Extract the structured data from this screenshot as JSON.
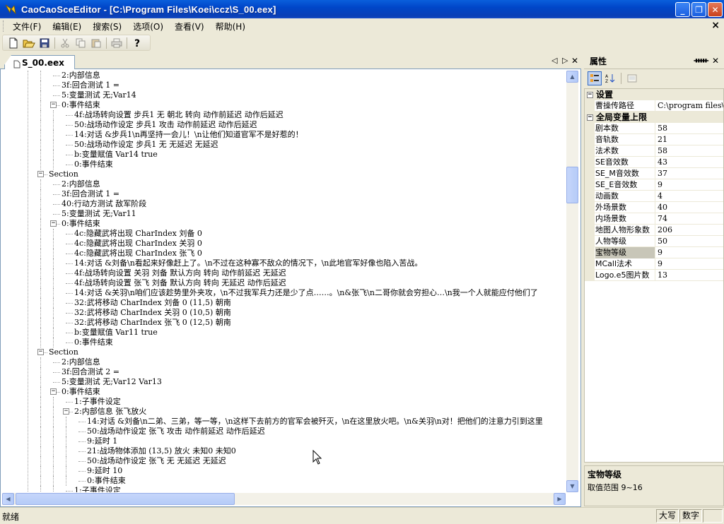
{
  "window": {
    "title": "CaoCaoSceEditor - [C:\\Program Files\\Koei\\ccz\\S_00.eex]",
    "minimize": "_",
    "restore": "❐",
    "close": "✕"
  },
  "menu": {
    "items": [
      "文件(F)",
      "编辑(E)",
      "搜索(S)",
      "选项(O)",
      "查看(V)",
      "帮助(H)"
    ],
    "mdi_close": "×"
  },
  "toolbar": {
    "buttons": [
      "new-icon",
      "open-icon",
      "save-icon",
      "cut-icon",
      "copy-icon",
      "paste-icon",
      "print-icon",
      "help-icon"
    ]
  },
  "document": {
    "tab_label": "S_00.eex",
    "tree": [
      {
        "d": 3,
        "t": "2:内部信息"
      },
      {
        "d": 3,
        "t": "3f:回合测试 1 ="
      },
      {
        "d": 3,
        "t": "5:变量测试 无;Var14"
      },
      {
        "d": 3,
        "t": "0:事件结束",
        "exp": true
      },
      {
        "d": 4,
        "t": "4f:战场转向设置 步兵1 无 朝北 转向 动作前延迟 动作后延迟"
      },
      {
        "d": 4,
        "t": "50:战场动作设定 步兵1 攻击 动作前延迟 动作后延迟"
      },
      {
        "d": 4,
        "t": "14:对话 &步兵1\\n再坚持一会儿！\\n让他们知道官军不是好惹的！"
      },
      {
        "d": 4,
        "t": "50:战场动作设定 步兵1 无 无延迟 无延迟"
      },
      {
        "d": 4,
        "t": "b:变量赋值 Var14 true"
      },
      {
        "d": 4,
        "t": "0:事件结束"
      },
      {
        "d": 2,
        "t": "Section",
        "exp": true
      },
      {
        "d": 3,
        "t": "2:内部信息"
      },
      {
        "d": 3,
        "t": "3f:回合测试 1 ="
      },
      {
        "d": 3,
        "t": "40:行动方测试 敌军阶段"
      },
      {
        "d": 3,
        "t": "5:变量测试 无;Var11"
      },
      {
        "d": 3,
        "t": "0:事件结束",
        "exp": true
      },
      {
        "d": 4,
        "t": "4c:隐藏武将出现 CharIndex 刘备 0"
      },
      {
        "d": 4,
        "t": "4c:隐藏武将出现 CharIndex 关羽 0"
      },
      {
        "d": 4,
        "t": "4c:隐藏武将出现 CharIndex 张飞 0"
      },
      {
        "d": 4,
        "t": "14:对话 &刘备\\n看起来好像赶上了。\\n不过在这种寡不敌众的情况下，\\n此地官军好像也陷入苦战。"
      },
      {
        "d": 4,
        "t": "4f:战场转向设置 关羽 刘备 默认方向 转向 动作前延迟 无延迟"
      },
      {
        "d": 4,
        "t": "4f:战场转向设置 张飞 刘备 默认方向 转向 无延迟 动作后延迟"
      },
      {
        "d": 4,
        "t": "14:对话 &关羽\\n咱们应该趁势里外夹攻，\\n不过我军兵力还是少了点……。\\n&张飞\\n二哥你就会穷担心…\\n我一个人就能应付他们了"
      },
      {
        "d": 4,
        "t": "32:武将移动 CharIndex 刘备 0 (11,5) 朝南"
      },
      {
        "d": 4,
        "t": "32:武将移动 CharIndex 关羽 0 (10,5) 朝南"
      },
      {
        "d": 4,
        "t": "32:武将移动 CharIndex 张飞 0 (12,5) 朝南"
      },
      {
        "d": 4,
        "t": "b:变量赋值 Var11 true"
      },
      {
        "d": 4,
        "t": "0:事件结束"
      },
      {
        "d": 2,
        "t": "Section",
        "exp": true
      },
      {
        "d": 3,
        "t": "2:内部信息"
      },
      {
        "d": 3,
        "t": "3f:回合测试 2 ="
      },
      {
        "d": 3,
        "t": "5:变量测试 无;Var12 Var13"
      },
      {
        "d": 3,
        "t": "0:事件结束",
        "exp": true
      },
      {
        "d": 4,
        "t": "1:子事件设定"
      },
      {
        "d": 4,
        "t": "2:内部信息 张飞放火",
        "exp": true
      },
      {
        "d": 5,
        "t": "14:对话 &刘备\\n二弟、三弟，等一等，\\n这样下去前方的官军会被歼灭，\\n在这里放火吧。\\n&关羽\\n对！把他们的注意力引到这里"
      },
      {
        "d": 5,
        "t": "50:战场动作设定 张飞 攻击 动作前延迟 动作后延迟"
      },
      {
        "d": 5,
        "t": "9:延时 1"
      },
      {
        "d": 5,
        "t": "21:战场物体添加 (13,5) 放火 未知0 未知0"
      },
      {
        "d": 5,
        "t": "50:战场动作设定 张飞 无 无延迟 无延迟"
      },
      {
        "d": 5,
        "t": "9:延时 10"
      },
      {
        "d": 5,
        "t": "0:事件结束"
      },
      {
        "d": 4,
        "t": "1:子事件设定"
      }
    ]
  },
  "properties": {
    "title": "属性",
    "pin": "ᚔ",
    "close": "✕",
    "groups": [
      {
        "name": "设置",
        "toggle": "−",
        "props": [
          {
            "name": "曹操传路径",
            "value": "C:\\program files\\koei\\ccz"
          }
        ]
      },
      {
        "name": "全局变量上限",
        "toggle": "−",
        "props": [
          {
            "name": "剧本数",
            "value": "58"
          },
          {
            "name": "音轨数",
            "value": "21"
          },
          {
            "name": "法术数",
            "value": "58"
          },
          {
            "name": "SE音效数",
            "value": "43"
          },
          {
            "name": "SE_M音效数",
            "value": "37"
          },
          {
            "name": "SE_E音效数",
            "value": "9"
          },
          {
            "name": "动画数",
            "value": "4"
          },
          {
            "name": "外场景数",
            "value": "40"
          },
          {
            "name": "内场景数",
            "value": "74"
          },
          {
            "name": "地图人物形象数",
            "value": "206"
          },
          {
            "name": "人物等级",
            "value": "50"
          },
          {
            "name": "宝物等级",
            "value": "9",
            "selected": true
          },
          {
            "name": "MCall法术",
            "value": "9"
          },
          {
            "name": "Logo.e5图片数",
            "value": "13"
          }
        ]
      }
    ],
    "description": {
      "title": "宝物等级",
      "text": "取值范围 9~16"
    }
  },
  "status": {
    "text": "就绪",
    "caps": "大写",
    "num": "数字"
  },
  "colors": {
    "titlebar": "#0a54d4",
    "accent": "#316ac5"
  }
}
